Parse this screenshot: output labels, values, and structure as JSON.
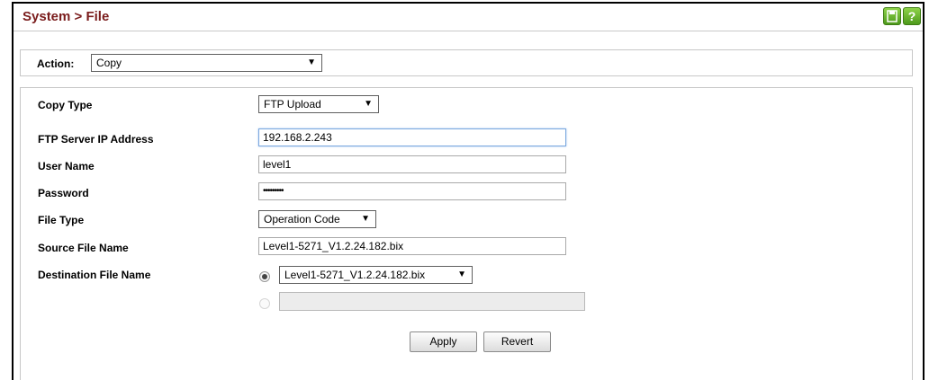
{
  "header": {
    "title": "System > File",
    "icons": [
      "save-icon",
      "help-icon"
    ]
  },
  "action": {
    "label": "Action:",
    "value": "Copy"
  },
  "form": {
    "copy_type": {
      "label": "Copy Type",
      "value": "FTP Upload"
    },
    "ftp_server": {
      "label": "FTP Server IP Address",
      "value": "192.168.2.243"
    },
    "user_name": {
      "label": "User Name",
      "value": "level1"
    },
    "password": {
      "label": "Password",
      "value": "•••••••••"
    },
    "file_type": {
      "label": "File Type",
      "value": "Operation Code"
    },
    "source_file": {
      "label": "Source File Name",
      "value": "Level1-5271_V1.2.24.182.bix"
    },
    "dest_file": {
      "label": "Destination File Name",
      "select_value": "Level1-5271_V1.2.24.182.bix",
      "text_value": ""
    }
  },
  "buttons": {
    "apply": "Apply",
    "revert": "Revert"
  },
  "colors": {
    "title": "#7a1c1c",
    "icon_green": "#5aa91f"
  }
}
